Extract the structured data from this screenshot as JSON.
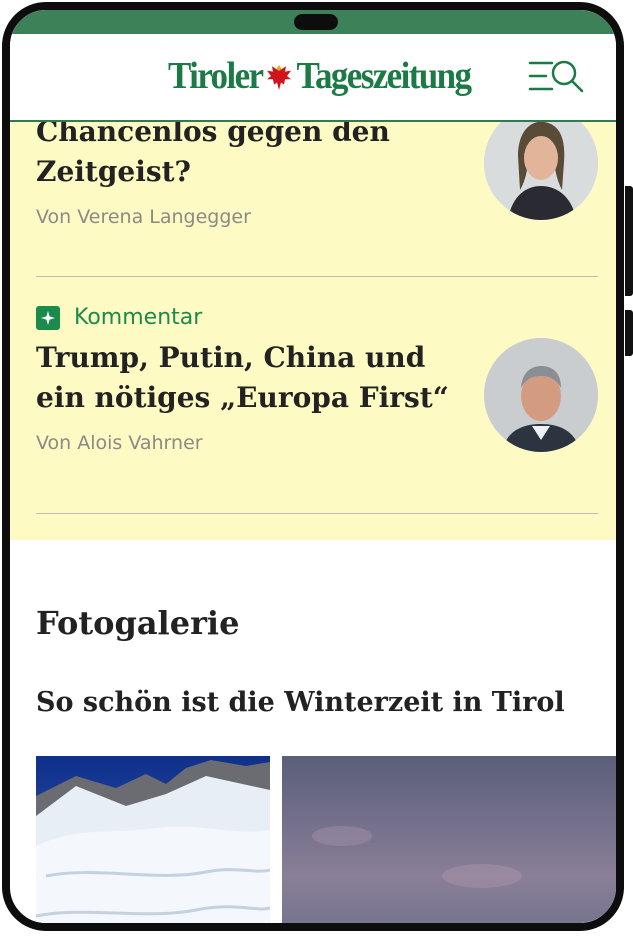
{
  "brand": {
    "logo_left": "Tiroler",
    "logo_right": "Tageszeitung",
    "accent": "#1b7a45",
    "status_bar_color": "#3d8159"
  },
  "header": {
    "menu_icon": "menu-search-icon"
  },
  "articles": [
    {
      "headline": "Chancenlos gegen den Zeitgeist?",
      "author": "Von Verena Langegger"
    },
    {
      "kicker": "Kommentar",
      "headline": "Trump, Putin, China und ein nötiges „Europa First“",
      "author": "Von Alois Vahrner"
    }
  ],
  "section": {
    "title": "Fotogalerie"
  },
  "gallery": {
    "title": "So schön ist die Winterzeit in Tirol"
  },
  "colors": {
    "highlight_bg": "#fdfbc3",
    "kicker": "#1b8a4c"
  }
}
